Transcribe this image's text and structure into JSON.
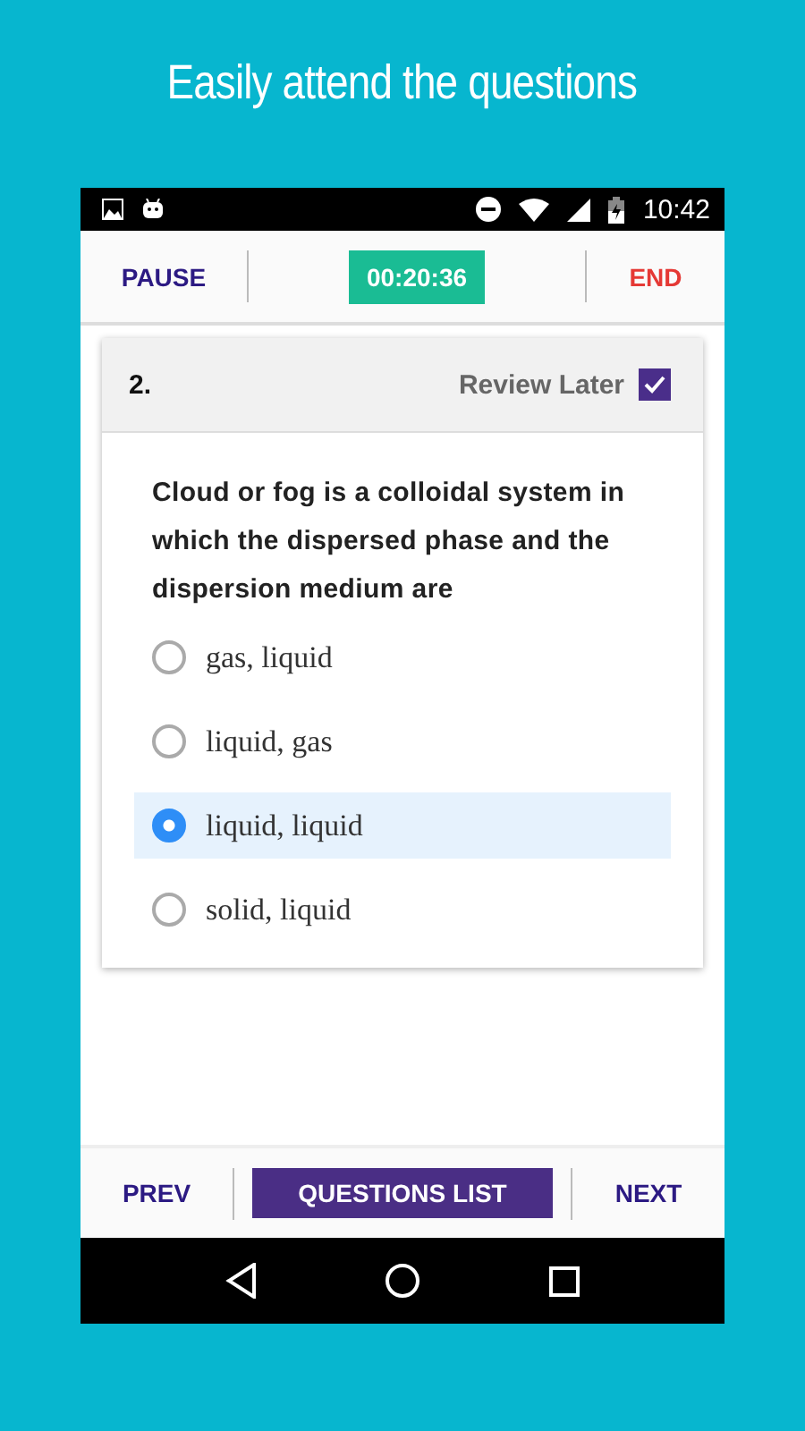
{
  "headline": "Easily attend the questions",
  "status_bar": {
    "time": "10:42"
  },
  "top_bar": {
    "pause": "PAUSE",
    "timer": "00:20:36",
    "end": "END"
  },
  "question": {
    "number": "2.",
    "review_label": "Review Later",
    "review_checked": true,
    "text": "Cloud or fog is a colloidal system in which the dispersed phase and the dispersion medium are",
    "options": [
      {
        "label": "gas, liquid",
        "selected": false
      },
      {
        "label": "liquid, gas",
        "selected": false
      },
      {
        "label": "liquid, liquid",
        "selected": true
      },
      {
        "label": "solid, liquid",
        "selected": false
      }
    ]
  },
  "bottom_bar": {
    "prev": "PREV",
    "list": "QUESTIONS LIST",
    "next": "NEXT"
  }
}
